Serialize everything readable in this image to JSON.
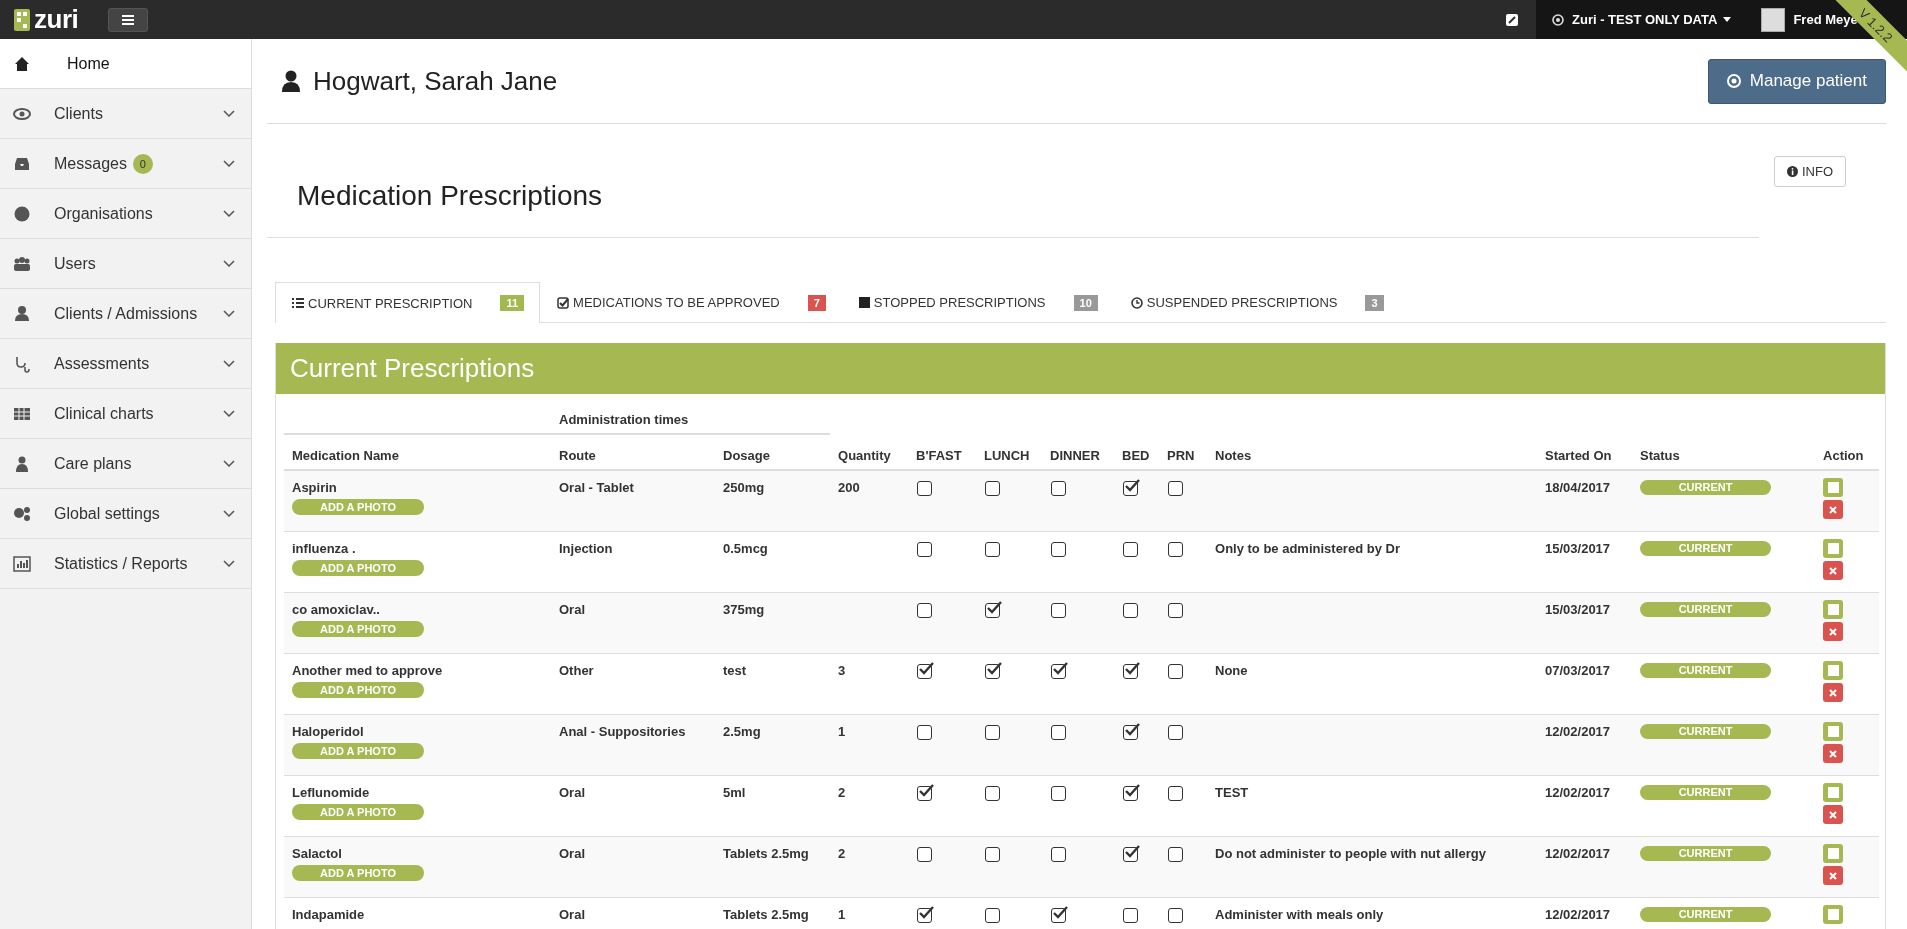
{
  "topbar": {
    "logo": "zuri",
    "org_menu": "Zuri - TEST ONLY DATA",
    "user": "Fred Meye",
    "version": "V 1.2.2"
  },
  "sidebar": {
    "items": [
      {
        "label": "Home",
        "selected": true,
        "expandable": false
      },
      {
        "label": "Clients",
        "selected": false,
        "expandable": true
      },
      {
        "label": "Messages",
        "selected": false,
        "expandable": true,
        "badge": "0"
      },
      {
        "label": "Organisations",
        "selected": false,
        "expandable": true
      },
      {
        "label": "Users",
        "selected": false,
        "expandable": true
      },
      {
        "label": "Clients / Admissions",
        "selected": false,
        "expandable": true
      },
      {
        "label": "Assessments",
        "selected": false,
        "expandable": true
      },
      {
        "label": "Clinical charts",
        "selected": false,
        "expandable": true
      },
      {
        "label": "Care plans",
        "selected": false,
        "expandable": true
      },
      {
        "label": "Global settings",
        "selected": false,
        "expandable": true
      },
      {
        "label": "Statistics / Reports",
        "selected": false,
        "expandable": true
      }
    ]
  },
  "patient": {
    "name": "Hogwart, Sarah Jane",
    "manage_button": "Manage patient"
  },
  "section": {
    "title": "Medication Prescriptions",
    "info_button": "INFO"
  },
  "tabs": [
    {
      "label": "CURRENT PRESCRIPTION",
      "badge": "11",
      "color": "#a3b84f",
      "selected": true
    },
    {
      "label": "MEDICATIONS TO BE APPROVED",
      "badge": "7",
      "color": "#d9534f",
      "selected": false
    },
    {
      "label": "STOPPED PRESCRIPTIONS",
      "badge": "10",
      "color": "#999999",
      "selected": false
    },
    {
      "label": "SUSPENDED PRESCRIPTIONS",
      "badge": "3",
      "color": "#999999",
      "selected": false
    }
  ],
  "panel": {
    "title": "Current Prescriptions",
    "group_header": "Administration times",
    "columns": [
      "Medication Name",
      "Route",
      "Dosage",
      "Quantity",
      "B'FAST",
      "LUNCH",
      "DINNER",
      "BED",
      "PRN",
      "Notes",
      "Started On",
      "Status",
      "Action"
    ],
    "rows": [
      {
        "name": "Aspirin",
        "photo_button": "ADD A PHOTO",
        "route": "Oral - Tablet",
        "dosage": "250mg",
        "quantity": "200",
        "times": [
          {
            "checked": false
          },
          {
            "checked": false
          },
          {
            "checked": false
          },
          {
            "checked": true
          },
          {
            "checked": false
          }
        ],
        "started": "18/04/2017",
        "status": "CURRENT"
      },
      {
        "name": "influenza .",
        "photo_button": "ADD A PHOTO",
        "route": "Injection",
        "dosage": "0.5mcg",
        "times": [
          {
            "checked": false
          },
          {
            "checked": false
          },
          {
            "checked": false
          },
          {
            "checked": false
          },
          {
            "checked": false
          }
        ],
        "notes": "Only to be administered by Dr",
        "started": "15/03/2017",
        "status": "CURRENT"
      },
      {
        "name": "co amoxiclav..",
        "photo_button": "ADD A PHOTO",
        "route": "Oral",
        "dosage": "375mg",
        "times": [
          {
            "checked": false
          },
          {
            "checked": true
          },
          {
            "checked": false
          },
          {
            "checked": false
          },
          {
            "checked": false
          }
        ],
        "started": "15/03/2017",
        "status": "CURRENT"
      },
      {
        "name": "Another med to approve",
        "photo_button": "ADD A PHOTO",
        "route": "Other",
        "dosage": "test",
        "quantity": "3",
        "times": [
          {
            "checked": true
          },
          {
            "checked": true
          },
          {
            "checked": true
          },
          {
            "checked": true
          },
          {
            "checked": false
          }
        ],
        "notes": "None",
        "started": "07/03/2017",
        "status": "CURRENT"
      },
      {
        "name": "Haloperidol",
        "photo_button": "ADD A PHOTO",
        "route": "Anal - Suppositories",
        "dosage": "2.5mg",
        "quantity": "1",
        "times": [
          {
            "checked": false
          },
          {
            "checked": false
          },
          {
            "checked": false
          },
          {
            "checked": true
          },
          {
            "checked": false
          }
        ],
        "started": "12/02/2017",
        "status": "CURRENT"
      },
      {
        "name": "Leflunomide",
        "photo_button": "ADD A PHOTO",
        "route": "Oral",
        "dosage": "5ml",
        "quantity": "2",
        "times": [
          {
            "checked": true
          },
          {
            "checked": false
          },
          {
            "checked": false
          },
          {
            "checked": true
          },
          {
            "checked": false
          }
        ],
        "notes": "TEST",
        "started": "12/02/2017",
        "status": "CURRENT"
      },
      {
        "name": "Salactol",
        "photo_button": "ADD A PHOTO",
        "route": "Oral",
        "dosage": "Tablets 2.5mg",
        "quantity": "2",
        "times": [
          {
            "checked": false
          },
          {
            "checked": false
          },
          {
            "checked": false
          },
          {
            "checked": true
          },
          {
            "checked": false
          }
        ],
        "notes": "Do not administer to people with nut allergy",
        "started": "12/02/2017",
        "status": "CURRENT"
      },
      {
        "name": "Indapamide",
        "route": "Oral",
        "dosage": "Tablets 2.5mg",
        "quantity": "1",
        "times": [
          {
            "checked": true
          },
          {
            "checked": false
          },
          {
            "checked": true
          },
          {
            "checked": false
          },
          {
            "checked": false
          }
        ],
        "notes": "Administer with meals only",
        "started": "12/02/2017",
        "status": "CURRENT"
      }
    ]
  }
}
